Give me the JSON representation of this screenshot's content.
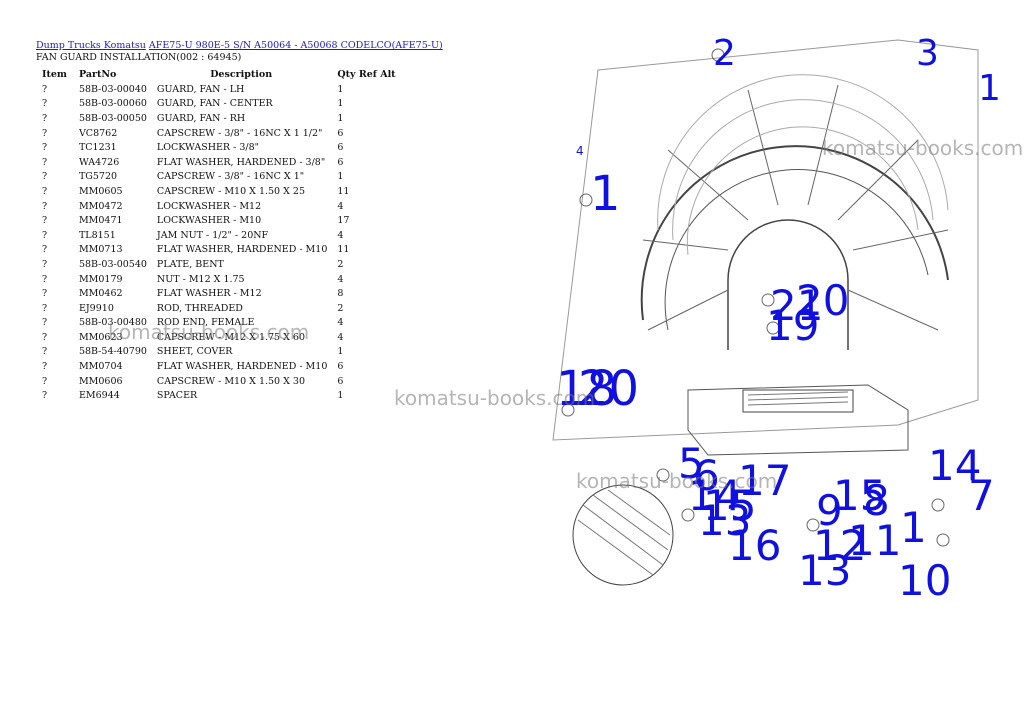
{
  "breadcrumb": {
    "link1": "Dump Trucks Komatsu",
    "link2": "AFE75-U 980E-5 S/N A50064 - A50068 CODELCO(AFE75-U)"
  },
  "subtitle": "FAN GUARD INSTALLATION(002 : 64945)",
  "table": {
    "headers": [
      "Item",
      "PartNo",
      "Description",
      "Qty Ref Alt"
    ],
    "rows": [
      {
        "item": "?",
        "partno": "58B-03-00040",
        "desc": "GUARD, FAN - LH",
        "qty": "1"
      },
      {
        "item": "?",
        "partno": "58B-03-00060",
        "desc": "GUARD, FAN - CENTER",
        "qty": "1"
      },
      {
        "item": "?",
        "partno": "58B-03-00050",
        "desc": "GUARD, FAN - RH",
        "qty": "1"
      },
      {
        "item": "?",
        "partno": "VC8762",
        "desc": "CAPSCREW - 3/8\" - 16NC X 1 1/2\"",
        "qty": "6"
      },
      {
        "item": "?",
        "partno": "TC1231",
        "desc": "LOCKWASHER - 3/8\"",
        "qty": "6"
      },
      {
        "item": "?",
        "partno": "WA4726",
        "desc": "FLAT WASHER, HARDENED - 3/8\"",
        "qty": "6"
      },
      {
        "item": "?",
        "partno": "TG5720",
        "desc": "CAPSCREW - 3/8\" - 16NC X 1\"",
        "qty": "1"
      },
      {
        "item": "?",
        "partno": "MM0605",
        "desc": "CAPSCREW - M10 X 1.50 X 25",
        "qty": "11"
      },
      {
        "item": "?",
        "partno": "MM0472",
        "desc": "LOCKWASHER - M12",
        "qty": "4"
      },
      {
        "item": "?",
        "partno": "MM0471",
        "desc": "LOCKWASHER - M10",
        "qty": "17"
      },
      {
        "item": "?",
        "partno": "TL8151",
        "desc": "JAM NUT - 1/2\" - 20NF",
        "qty": "4"
      },
      {
        "item": "?",
        "partno": "MM0713",
        "desc": "FLAT WASHER, HARDENED - M10",
        "qty": "11"
      },
      {
        "item": "?",
        "partno": "58B-03-00540",
        "desc": "PLATE, BENT",
        "qty": "2"
      },
      {
        "item": "?",
        "partno": "MM0179",
        "desc": "NUT - M12 X 1.75",
        "qty": "4"
      },
      {
        "item": "?",
        "partno": "MM0462",
        "desc": "FLAT WASHER - M12",
        "qty": "8"
      },
      {
        "item": "?",
        "partno": "EJ9910",
        "desc": "ROD, THREADED",
        "qty": "2"
      },
      {
        "item": "?",
        "partno": "58B-03-00480",
        "desc": "ROD END, FEMALE",
        "qty": "4"
      },
      {
        "item": "?",
        "partno": "MM0623",
        "desc": "CAPSCREW - M12 X 1.75 X 60",
        "qty": "4"
      },
      {
        "item": "?",
        "partno": "58B-54-40790",
        "desc": "SHEET, COVER",
        "qty": "1"
      },
      {
        "item": "?",
        "partno": "MM0704",
        "desc": "FLAT WASHER, HARDENED - M10",
        "qty": "6"
      },
      {
        "item": "?",
        "partno": "MM0606",
        "desc": "CAPSCREW - M10 X 1.50 X 30",
        "qty": "6"
      },
      {
        "item": "?",
        "partno": "EM6944",
        "desc": "SPACER",
        "qty": "1"
      }
    ]
  },
  "watermark": "komatsu-books.com",
  "callouts": [
    "2",
    "3",
    "1",
    "4",
    "1",
    "21",
    "20",
    "19",
    "18",
    "20",
    "5",
    "6",
    "14",
    "15",
    "17",
    "13",
    "16",
    "12",
    "11",
    "9",
    "15",
    "8",
    "1",
    "14",
    "7",
    "13",
    "10"
  ],
  "colors": {
    "link": "#1a1ad0",
    "callout": "#1010e0",
    "watermark": "#808080"
  }
}
